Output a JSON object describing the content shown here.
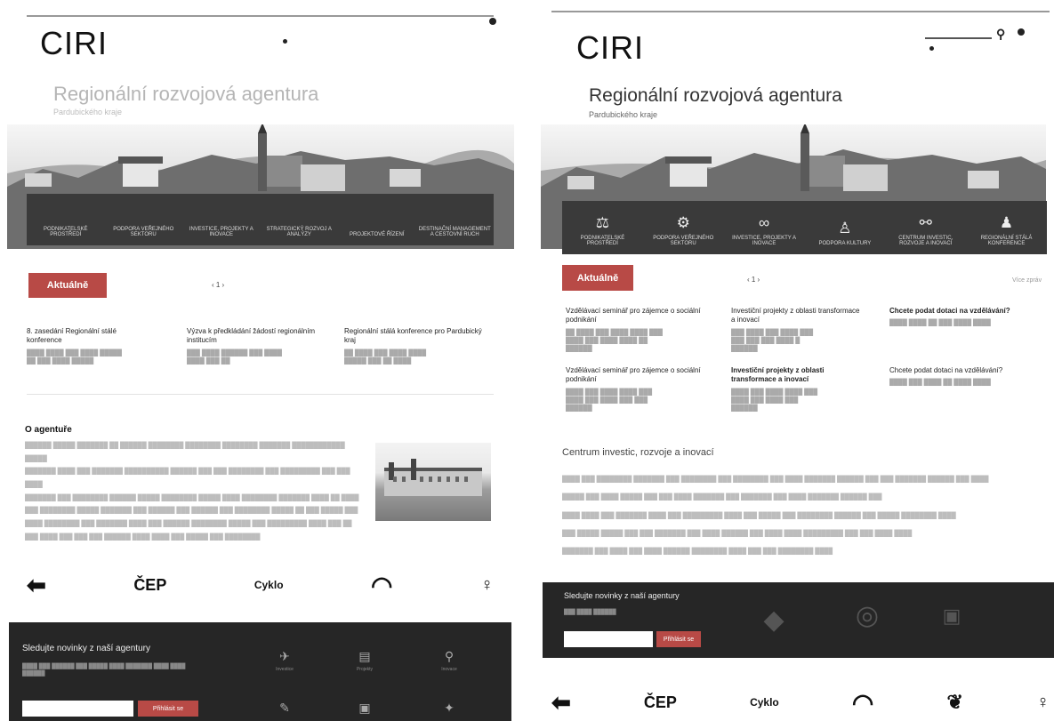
{
  "pages": [
    {
      "brand": "CIRI",
      "tagline": "Regionální rozvojová agentura",
      "subtitle": "Pardubického kraje",
      "nav": [
        "Podnikatelské prostředí",
        "Podpora veřejného sektoru",
        "Investice, projekty a inovace",
        "Strategický rozvoj a analýzy",
        "Projektové řízení",
        "Destinační management a cestovní ruch"
      ],
      "aktualne": "Aktuálně",
      "pager": "‹ 1 ›",
      "news": [
        {
          "title": "8. zasedání Regionální stálé konference",
          "desc": ""
        },
        {
          "title": "Výzva k předkládání žádostí regionálním institucím",
          "desc": ""
        },
        {
          "title": "Regionální stálá konference pro Pardubický kraj",
          "desc": ""
        }
      ],
      "about_title": "O agentuře",
      "footer_title": "Sledujte novinky z naší agentury",
      "footer_button": "Přihlásit se",
      "footer_items": [
        "Investice",
        "Projekty",
        "Inovace"
      ]
    },
    {
      "brand": "CIRI",
      "tagline": "Regionální rozvojová agentura",
      "subtitle": "Pardubického kraje",
      "nav": [
        "Podnikatelské prostředí",
        "Podpora veřejného sektoru",
        "Investice, projekty a inovace",
        "Podpora kultury",
        "Centrum investic, rozvoje a inovací",
        "Regionální stálá konference"
      ],
      "aktualne": "Aktuálně",
      "pager": "‹ 1 ›",
      "more": "Více zpráv",
      "news": [
        {
          "title": "Vzdělávací seminář pro zájemce o sociální podnikání",
          "desc": "",
          "bold": false
        },
        {
          "title": "Investiční projekty z oblasti transformace a inovací",
          "desc": "",
          "bold": false
        },
        {
          "title": "Chcete podat dotaci na vzdělávání?",
          "desc": "",
          "bold": true
        },
        {
          "title": "Vzdělávací seminář pro zájemce o sociální podnikání",
          "desc": "",
          "bold": false
        },
        {
          "title": "Investiční projekty z oblasti transformace a inovací",
          "desc": "",
          "bold": true
        },
        {
          "title": "Chcete podat dotaci na vzdělávání?",
          "desc": "",
          "bold": false
        }
      ],
      "section_title": "Centrum investic, rozvoje a inovací",
      "footer_title": "Sledujte novinky z naší agentury",
      "footer_button": "Přihlásit se"
    }
  ],
  "partners": [
    "⬅",
    "ČEP",
    "Cyklo",
    "◠",
    "♀"
  ],
  "colors": {
    "accent": "#b84a46",
    "nav": "#3a3a3a",
    "footer": "#262626"
  }
}
